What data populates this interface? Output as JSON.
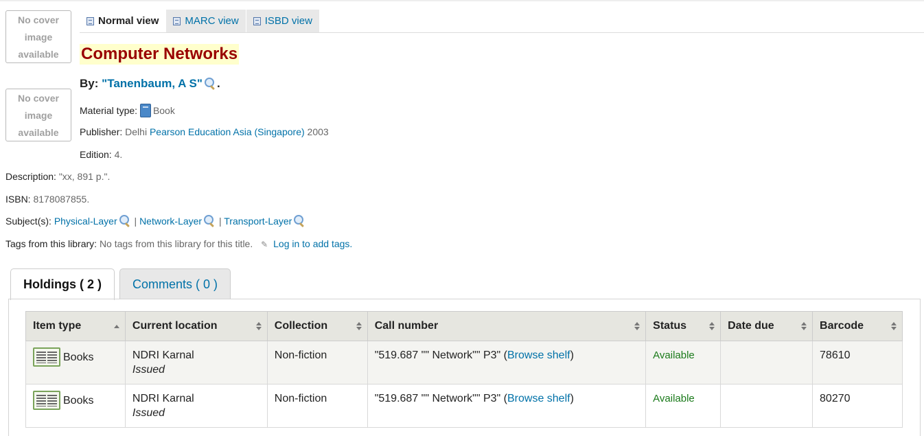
{
  "covers": [
    {
      "lines": [
        "No cover",
        "image",
        "available"
      ]
    },
    {
      "lines": [
        "No cover",
        "image",
        "available"
      ]
    }
  ],
  "view_tabs": [
    {
      "label": "Normal view",
      "icon": "document-icon",
      "active": true
    },
    {
      "label": "MARC view",
      "icon": "list-icon",
      "active": false
    },
    {
      "label": "ISBD view",
      "icon": "card-icon",
      "active": false
    }
  ],
  "record": {
    "title": "Computer Networks",
    "by_label": "By:",
    "author": "\"Tanenbaum, A S\"",
    "author_suffix": ".",
    "material_type_label": "Material type:",
    "material_type": "Book",
    "publisher_label": "Publisher:",
    "publisher_place": "Delhi",
    "publisher_name": "Pearson Education Asia (Singapore)",
    "publisher_year": "2003",
    "edition_label": "Edition:",
    "edition": "4.",
    "description_label": "Description:",
    "description": "\"xx, 891 p.\".",
    "isbn_label": "ISBN:",
    "isbn": "8178087855.",
    "subjects_label": "Subject(s):",
    "subjects": [
      "Physical-Layer",
      "Network-Layer",
      "Transport-Layer"
    ],
    "subject_separator": "|",
    "tags_label": "Tags from this library:",
    "tags_value": "No tags from this library for this title.",
    "tags_login": "Log in to add tags."
  },
  "holding_tabs": [
    {
      "label": "Holdings ( 2 )",
      "active": true
    },
    {
      "label": "Comments ( 0 )",
      "active": false
    }
  ],
  "holdings": {
    "columns": [
      "Item type",
      "Current location",
      "Collection",
      "Call number",
      "Status",
      "Date due",
      "Barcode"
    ],
    "rows": [
      {
        "item_type": "Books",
        "location": "NDRI Karnal",
        "location_status": "Issued",
        "collection": "Non-fiction",
        "call_number": "\"519.687 \"\" Network\"\" P3\" (",
        "browse": "Browse shelf",
        "call_close": ")",
        "status": "Available",
        "date_due": "",
        "barcode": "78610"
      },
      {
        "item_type": "Books",
        "location": "NDRI Karnal",
        "location_status": "Issued",
        "collection": "Non-fiction",
        "call_number": "\"519.687 \"\" Network\"\" P3\" (",
        "browse": "Browse shelf",
        "call_close": ")",
        "status": "Available",
        "date_due": "",
        "barcode": "80270"
      }
    ]
  }
}
